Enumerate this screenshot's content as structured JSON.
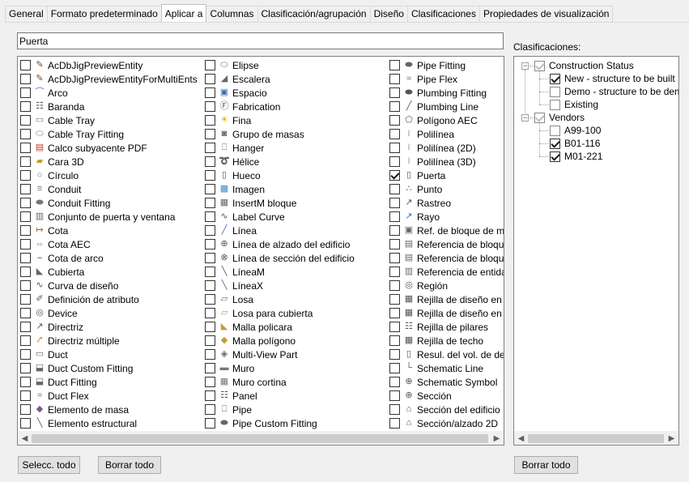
{
  "tabs": [
    "General",
    "Formato predeterminado",
    "Aplicar a",
    "Columnas",
    "Clasificación/agrupación",
    "Diseño",
    "Clasificaciones",
    "Propiedades de visualización"
  ],
  "active_tab": "Aplicar a",
  "search": {
    "value": "Puerta"
  },
  "objects": {
    "col1": [
      {
        "label": "AcDbJigPreviewEntity",
        "icon": "brush-icon",
        "checked": false
      },
      {
        "label": "AcDbJigPreviewEntityForMultiEnts",
        "icon": "brush-icon",
        "checked": false
      },
      {
        "label": "Arco",
        "icon": "arc-icon",
        "checked": false
      },
      {
        "label": "Baranda",
        "icon": "railing-icon",
        "checked": false
      },
      {
        "label": "Cable Tray",
        "icon": "cable-tray-icon",
        "checked": false
      },
      {
        "label": "Cable Tray Fitting",
        "icon": "cable-tray-fitting-icon",
        "checked": false
      },
      {
        "label": "Calco subyacente PDF",
        "icon": "pdf-icon",
        "checked": false
      },
      {
        "label": "Cara 3D",
        "icon": "face-3d-icon",
        "checked": false
      },
      {
        "label": "Círculo",
        "icon": "circle-icon",
        "checked": false
      },
      {
        "label": "Conduit",
        "icon": "conduit-icon",
        "checked": false
      },
      {
        "label": "Conduit Fitting",
        "icon": "conduit-fitting-icon",
        "checked": false
      },
      {
        "label": "Conjunto de puerta y ventana",
        "icon": "door-window-assembly-icon",
        "checked": false
      },
      {
        "label": "Cota",
        "icon": "dimension-icon",
        "checked": false
      },
      {
        "label": "Cota AEC",
        "icon": "aec-dimension-icon",
        "checked": false
      },
      {
        "label": "Cota de arco",
        "icon": "arc-dimension-icon",
        "checked": false
      },
      {
        "label": "Cubierta",
        "icon": "roof-icon",
        "checked": false
      },
      {
        "label": "Curva de diseño",
        "icon": "layout-curve-icon",
        "checked": false
      },
      {
        "label": "Definición de atributo",
        "icon": "attribute-icon",
        "checked": false
      },
      {
        "label": "Device",
        "icon": "device-icon",
        "checked": false
      },
      {
        "label": "Directriz",
        "icon": "leader-icon",
        "checked": false
      },
      {
        "label": "Directriz múltiple",
        "icon": "multileader-icon",
        "checked": false
      },
      {
        "label": "Duct",
        "icon": "duct-icon",
        "checked": false
      },
      {
        "label": "Duct Custom Fitting",
        "icon": "duct-custom-fitting-icon",
        "checked": false
      },
      {
        "label": "Duct Fitting",
        "icon": "duct-fitting-icon",
        "checked": false
      },
      {
        "label": "Duct Flex",
        "icon": "duct-flex-icon",
        "checked": false
      },
      {
        "label": "Elemento de masa",
        "icon": "mass-element-icon",
        "checked": false
      },
      {
        "label": "Elemento estructural",
        "icon": "structural-member-icon",
        "checked": false
      }
    ],
    "col2": [
      {
        "label": "Elipse",
        "icon": "ellipse-icon",
        "checked": false
      },
      {
        "label": "Escalera",
        "icon": "stair-icon",
        "checked": false
      },
      {
        "label": "Espacio",
        "icon": "space-icon",
        "checked": false
      },
      {
        "label": "Fabrication",
        "icon": "fabrication-icon",
        "checked": false
      },
      {
        "label": "Fina",
        "icon": "light-bulb-icon",
        "checked": false
      },
      {
        "label": "Grupo de masas",
        "icon": "mass-group-icon",
        "checked": false
      },
      {
        "label": "Hanger",
        "icon": "hanger-icon",
        "checked": false
      },
      {
        "label": "Hélice",
        "icon": "helix-icon",
        "checked": false
      },
      {
        "label": "Hueco",
        "icon": "opening-icon",
        "checked": false
      },
      {
        "label": "Imagen",
        "icon": "image-icon",
        "checked": false
      },
      {
        "label": "InsertM bloque",
        "icon": "minsert-block-icon",
        "checked": false
      },
      {
        "label": "Label Curve",
        "icon": "label-curve-icon",
        "checked": false
      },
      {
        "label": "Línea",
        "icon": "line-icon",
        "checked": false
      },
      {
        "label": "Línea de alzado del edificio",
        "icon": "elevation-line-icon",
        "checked": false
      },
      {
        "label": "Línea de sección del edificio",
        "icon": "section-line-icon",
        "checked": false
      },
      {
        "label": "LíneaM",
        "icon": "mline-icon",
        "checked": false
      },
      {
        "label": "LíneaX",
        "icon": "xline-icon",
        "checked": false
      },
      {
        "label": "Losa",
        "icon": "slab-icon",
        "checked": false
      },
      {
        "label": "Losa para cubierta",
        "icon": "roof-slab-icon",
        "checked": false
      },
      {
        "label": "Malla policara",
        "icon": "polyface-mesh-icon",
        "checked": false
      },
      {
        "label": "Malla polígono",
        "icon": "polygon-mesh-icon",
        "checked": false
      },
      {
        "label": "Multi-View Part",
        "icon": "multi-view-part-icon",
        "checked": false
      },
      {
        "label": "Muro",
        "icon": "wall-icon",
        "checked": false
      },
      {
        "label": "Muro cortina",
        "icon": "curtain-wall-icon",
        "checked": false
      },
      {
        "label": "Panel",
        "icon": "panel-icon",
        "checked": false
      },
      {
        "label": "Pipe",
        "icon": "pipe-icon",
        "checked": false
      },
      {
        "label": "Pipe Custom Fitting",
        "icon": "pipe-custom-fitting-icon",
        "checked": false
      }
    ],
    "col3": [
      {
        "label": "Pipe Fitting",
        "icon": "pipe-fitting-icon",
        "checked": false
      },
      {
        "label": "Pipe Flex",
        "icon": "pipe-flex-icon",
        "checked": false
      },
      {
        "label": "Plumbing Fitting",
        "icon": "plumbing-fitting-icon",
        "checked": false
      },
      {
        "label": "Plumbing Line",
        "icon": "plumbing-line-icon",
        "checked": false
      },
      {
        "label": "Polígono AEC",
        "icon": "aec-polygon-icon",
        "checked": false
      },
      {
        "label": "Polilínea",
        "icon": "polyline-icon",
        "checked": false
      },
      {
        "label": "Polilínea (2D)",
        "icon": "polyline-2d-icon",
        "checked": false
      },
      {
        "label": "Polilínea (3D)",
        "icon": "polyline-3d-icon",
        "checked": false
      },
      {
        "label": "Puerta",
        "icon": "door-icon",
        "checked": true
      },
      {
        "label": "Punto",
        "icon": "point-icon",
        "checked": false
      },
      {
        "label": "Rastreo",
        "icon": "trace-icon",
        "checked": false
      },
      {
        "label": "Rayo",
        "icon": "ray-icon",
        "checked": false
      },
      {
        "label": "Ref. de bloque de m",
        "icon": "block-ref-icon",
        "checked": false
      },
      {
        "label": "Referencia de bloqu",
        "icon": "block-reference-icon",
        "checked": false
      },
      {
        "label": "Referencia de bloqu",
        "icon": "block-reference-2-icon",
        "checked": false
      },
      {
        "label": "Referencia de entida",
        "icon": "entity-reference-icon",
        "checked": false
      },
      {
        "label": "Región",
        "icon": "region-icon",
        "checked": false
      },
      {
        "label": "Rejilla de diseño en",
        "icon": "layout-grid-icon",
        "checked": false
      },
      {
        "label": "Rejilla de diseño en",
        "icon": "layout-grid-2-icon",
        "checked": false
      },
      {
        "label": "Rejilla de pilares",
        "icon": "column-grid-icon",
        "checked": false
      },
      {
        "label": "Rejilla de techo",
        "icon": "ceiling-grid-icon",
        "checked": false
      },
      {
        "label": "Resul. del vol. de de",
        "icon": "volume-result-icon",
        "checked": false
      },
      {
        "label": "Schematic Line",
        "icon": "schematic-line-icon",
        "checked": false
      },
      {
        "label": "Schematic Symbol",
        "icon": "schematic-symbol-icon",
        "checked": false
      },
      {
        "label": "Sección",
        "icon": "section-icon",
        "checked": false
      },
      {
        "label": "Sección del edificio",
        "icon": "building-section-icon",
        "checked": false
      },
      {
        "label": "Sección/alzado 2D",
        "icon": "section-elevation-2d-icon",
        "checked": false
      }
    ]
  },
  "classifications": {
    "label": "Clasificaciones:",
    "groups": [
      {
        "name": "Construction Status",
        "checked": "gray",
        "children": [
          {
            "name": "New - structure to be built",
            "checked": "checked"
          },
          {
            "name": "Demo - structure to be demolis",
            "checked": "none"
          },
          {
            "name": "Existing",
            "checked": "none"
          }
        ]
      },
      {
        "name": "Vendors",
        "checked": "gray",
        "children": [
          {
            "name": "A99-100",
            "checked": "none"
          },
          {
            "name": "B01-116",
            "checked": "checked"
          },
          {
            "name": "M01-221",
            "checked": "checked"
          }
        ]
      }
    ]
  },
  "buttons": {
    "select_all": "Selecc. todo",
    "clear_all": "Borrar todo",
    "clear_all_right": "Borrar todo"
  }
}
